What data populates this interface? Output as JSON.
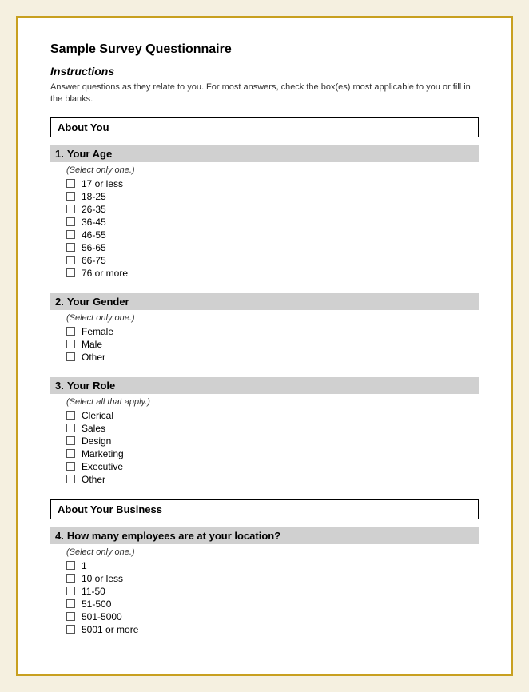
{
  "page": {
    "title": "Sample Survey Questionnaire",
    "instructions_label": "Instructions",
    "instructions_text": "Answer questions as they relate to you. For most answers, check the box(es) most applicable to you or fill in the blanks."
  },
  "sections": [
    {
      "id": "about-you",
      "label": "About You",
      "questions": [
        {
          "number": "1.",
          "label": "Your Age",
          "note": "(Select only one.)",
          "options": [
            "17 or less",
            "18-25",
            "26-35",
            "36-45",
            "46-55",
            "56-65",
            "66-75",
            "76 or more"
          ]
        },
        {
          "number": "2.",
          "label": "Your Gender",
          "note": "(Select only one.)",
          "options": [
            "Female",
            "Male",
            "Other"
          ]
        },
        {
          "number": "3.",
          "label": "Your Role",
          "note": "(Select all that apply.)",
          "options": [
            "Clerical",
            "Sales",
            "Design",
            "Marketing",
            "Executive",
            "Other"
          ]
        }
      ]
    },
    {
      "id": "about-your-business",
      "label": "About Your Business",
      "questions": [
        {
          "number": "4.",
          "label": "How many employees are at your location?",
          "note": "(Select only one.)",
          "options": [
            "1",
            "10 or less",
            "11-50",
            "51-500",
            "501-5000",
            "5001 or more"
          ]
        }
      ]
    }
  ]
}
